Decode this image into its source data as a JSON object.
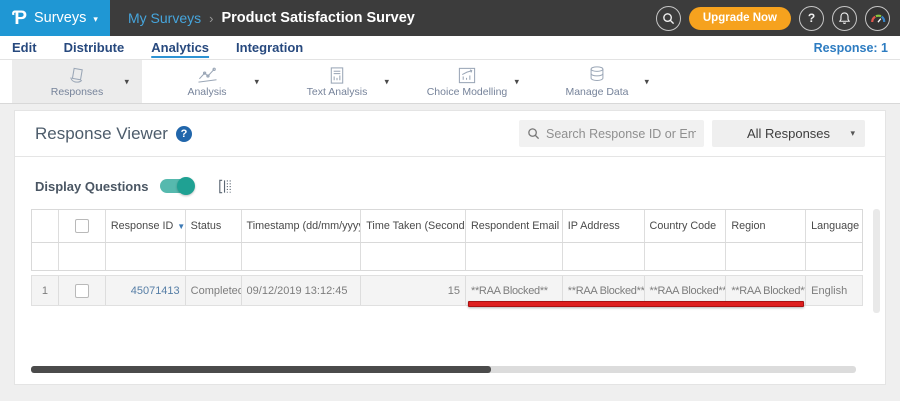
{
  "topbar": {
    "logo_glyph": "Ƥ",
    "app_menu": "Surveys",
    "breadcrumb": {
      "parent": "My Surveys",
      "separator": "›",
      "current": "Product Satisfaction Survey"
    },
    "upgrade_label": "Upgrade Now",
    "help_glyph": "?"
  },
  "nav": {
    "tabs": [
      "Edit",
      "Distribute",
      "Analytics",
      "Integration"
    ],
    "active_tab": "Analytics",
    "response_count_label": "Response: 1"
  },
  "ribbon": {
    "items": [
      {
        "label": "Responses",
        "icon": "responses-icon",
        "active": true
      },
      {
        "label": "Analysis",
        "icon": "analysis-icon",
        "active": false
      },
      {
        "label": "Text Analysis",
        "icon": "text-analysis-icon",
        "active": false
      },
      {
        "label": "Choice Modelling",
        "icon": "choice-modelling-icon",
        "active": false
      },
      {
        "label": "Manage Data",
        "icon": "manage-data-icon",
        "active": false
      }
    ]
  },
  "viewer": {
    "title": "Response Viewer",
    "help_glyph": "?",
    "search_placeholder": "Search Response ID or Email",
    "response_filter": "All Responses",
    "display_questions_label": "Display Questions",
    "display_questions_on": true
  },
  "table": {
    "headers": {
      "response_id": "Response ID",
      "status": "Status",
      "timestamp": "Timestamp (dd/mm/yyyy)",
      "time_taken": "Time Taken (Seconds)",
      "respondent_email": "Respondent Email",
      "ip_address": "IP Address",
      "country_code": "Country Code",
      "region": "Region",
      "language": "Language"
    },
    "rows": [
      {
        "num": "1",
        "response_id": "45071413",
        "status": "Completed",
        "timestamp": "09/12/2019 13:12:45",
        "time_taken": "15",
        "respondent_email": "**RAA Blocked**",
        "ip_address": "**RAA Blocked**",
        "country_code": "**RAA Blocked**",
        "region": "**RAA Blocked**",
        "language": "English"
      }
    ]
  },
  "icons": {
    "caret_down": "▾",
    "sort_desc": "▼",
    "sort_both": "⇅"
  },
  "colors": {
    "brand_blue": "#1f97d4",
    "topbar_bg": "#3c3c3c",
    "upgrade_orange": "#f6a21e",
    "accent_teal": "#27a598",
    "nav_link": "#27497e",
    "annotation_red": "#de1e1e"
  }
}
